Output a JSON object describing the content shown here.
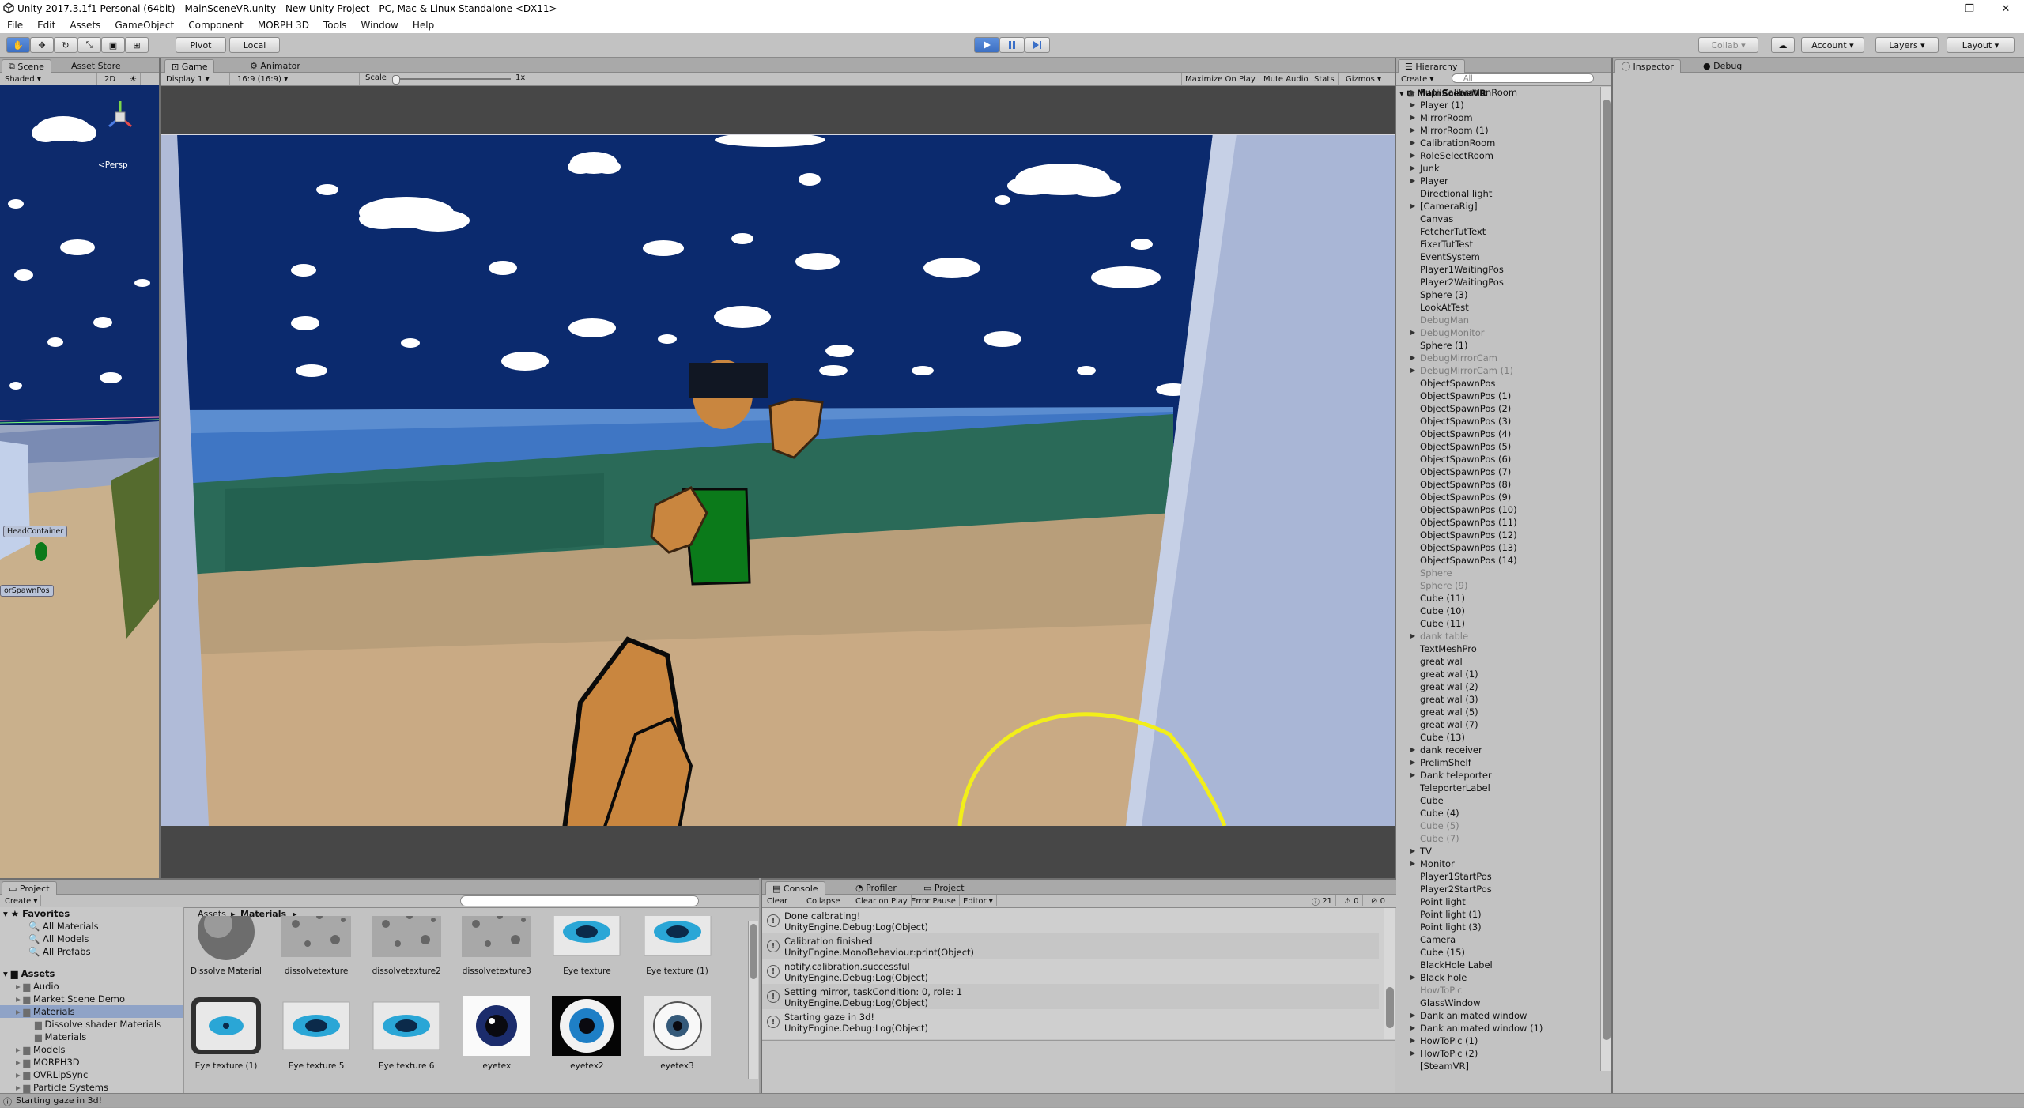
{
  "window": {
    "title": "Unity 2017.3.1f1 Personal (64bit) - MainSceneVR.unity - New Unity Project - PC, Mac & Linux Standalone <DX11>"
  },
  "menu": [
    "File",
    "Edit",
    "Assets",
    "GameObject",
    "Component",
    "MORPH 3D",
    "Tools",
    "Window",
    "Help"
  ],
  "toolbar": {
    "pivot": "Pivot",
    "local": "Local",
    "collab": "Collab",
    "account": "Account",
    "layers": "Layers",
    "layout": "Layout"
  },
  "scene": {
    "tab": "Scene",
    "asset_store": "Asset Store",
    "shaded": "Shaded",
    "mode2d": "2D",
    "persp": "<Persp",
    "head_label": "HeadContainer",
    "spawn_label": "orSpawnPos"
  },
  "game": {
    "tab": "Game",
    "animator": "Animator",
    "display": "Display 1",
    "ratio": "16:9 (16:9)",
    "scale_label": "Scale",
    "scale_value": "1x",
    "maximize": "Maximize On Play",
    "mute": "Mute Audio",
    "stats": "Stats",
    "gizmos": "Gizmos"
  },
  "hierarchy": {
    "tab": "Hierarchy",
    "create": "Create",
    "search_placeholder": "All",
    "root": "MainSceneVR",
    "items": [
      {
        "label": "PupilCalibrationRoom",
        "arrow": true
      },
      {
        "label": "Player (1)",
        "arrow": true
      },
      {
        "label": "MirrorRoom",
        "arrow": true
      },
      {
        "label": "MirrorRoom (1)",
        "arrow": true
      },
      {
        "label": "CalibrationRoom",
        "arrow": true
      },
      {
        "label": "RoleSelectRoom",
        "arrow": true
      },
      {
        "label": "Junk",
        "arrow": true
      },
      {
        "label": "Player",
        "arrow": true
      },
      {
        "label": "Directional light"
      },
      {
        "label": "[CameraRig]",
        "arrow": true
      },
      {
        "label": "Canvas"
      },
      {
        "label": "FetcherTutText"
      },
      {
        "label": "FixerTutTest"
      },
      {
        "label": "EventSystem"
      },
      {
        "label": "Player1WaitingPos"
      },
      {
        "label": "Player2WaitingPos"
      },
      {
        "label": "Sphere (3)"
      },
      {
        "label": "LookAtTest"
      },
      {
        "label": "DebugMan",
        "dim": true
      },
      {
        "label": "DebugMonitor",
        "arrow": true,
        "dim": true
      },
      {
        "label": "Sphere (1)"
      },
      {
        "label": "DebugMirrorCam",
        "arrow": true,
        "dim": true
      },
      {
        "label": "DebugMirrorCam (1)",
        "arrow": true,
        "dim": true
      },
      {
        "label": "ObjectSpawnPos"
      },
      {
        "label": "ObjectSpawnPos (1)"
      },
      {
        "label": "ObjectSpawnPos (2)"
      },
      {
        "label": "ObjectSpawnPos (3)"
      },
      {
        "label": "ObjectSpawnPos (4)"
      },
      {
        "label": "ObjectSpawnPos (5)"
      },
      {
        "label": "ObjectSpawnPos (6)"
      },
      {
        "label": "ObjectSpawnPos (7)"
      },
      {
        "label": "ObjectSpawnPos (8)"
      },
      {
        "label": "ObjectSpawnPos (9)"
      },
      {
        "label": "ObjectSpawnPos (10)"
      },
      {
        "label": "ObjectSpawnPos (11)"
      },
      {
        "label": "ObjectSpawnPos (12)"
      },
      {
        "label": "ObjectSpawnPos (13)"
      },
      {
        "label": "ObjectSpawnPos (14)"
      },
      {
        "label": "Sphere",
        "dim": true
      },
      {
        "label": "Sphere (9)",
        "dim": true
      },
      {
        "label": "Cube (11)"
      },
      {
        "label": "Cube (10)"
      },
      {
        "label": "Cube (11)"
      },
      {
        "label": "dank table",
        "arrow": true,
        "dim": true
      },
      {
        "label": "TextMeshPro"
      },
      {
        "label": "great wal"
      },
      {
        "label": "great wal (1)"
      },
      {
        "label": "great wal (2)"
      },
      {
        "label": "great wal (3)"
      },
      {
        "label": "great wal (5)"
      },
      {
        "label": "great wal (7)"
      },
      {
        "label": "Cube (13)"
      },
      {
        "label": "dank receiver",
        "arrow": true
      },
      {
        "label": "PrelimShelf",
        "arrow": true
      },
      {
        "label": "Dank teleporter",
        "arrow": true
      },
      {
        "label": "TeleporterLabel"
      },
      {
        "label": "Cube"
      },
      {
        "label": "Cube (4)"
      },
      {
        "label": "Cube (5)",
        "dim": true
      },
      {
        "label": "Cube (7)",
        "dim": true
      },
      {
        "label": "TV",
        "arrow": true
      },
      {
        "label": "Monitor",
        "arrow": true
      },
      {
        "label": "Player1StartPos"
      },
      {
        "label": "Player2StartPos"
      },
      {
        "label": "Point light"
      },
      {
        "label": "Point light (1)"
      },
      {
        "label": "Point light (3)"
      },
      {
        "label": "Camera"
      },
      {
        "label": "Cube (15)"
      },
      {
        "label": "BlackHole Label"
      },
      {
        "label": "Black hole",
        "arrow": true
      },
      {
        "label": "HowToPic",
        "dim": true
      },
      {
        "label": "GlassWindow"
      },
      {
        "label": "Dank animated window",
        "arrow": true
      },
      {
        "label": "Dank animated window (1)",
        "arrow": true
      },
      {
        "label": "HowToPic (1)",
        "arrow": true
      },
      {
        "label": "HowToPic (2)",
        "arrow": true
      },
      {
        "label": "[SteamVR]"
      }
    ]
  },
  "inspector": {
    "tab": "Inspector",
    "debug": "Debug"
  },
  "project": {
    "tab": "Project",
    "create": "Create",
    "breadcrumb_root": "Assets",
    "breadcrumb_current": "Materials",
    "favorites": "Favorites",
    "fav_items": [
      "All Materials",
      "All Models",
      "All Prefabs"
    ],
    "assets": "Assets",
    "tree": [
      {
        "label": "Audio",
        "indent": 1
      },
      {
        "label": "Market Scene Demo",
        "indent": 1
      },
      {
        "label": "Materials",
        "indent": 1,
        "selected": true
      },
      {
        "label": "Dissolve shader Materials",
        "indent": 2
      },
      {
        "label": "Materials",
        "indent": 2
      },
      {
        "label": "Models",
        "indent": 1
      },
      {
        "label": "MORPH3D",
        "indent": 1
      },
      {
        "label": "OVRLipSync",
        "indent": 1
      },
      {
        "label": "Particle Systems",
        "indent": 1
      }
    ],
    "tiles_row1": [
      "Dissolve Material",
      "dissolvetexture",
      "dissolvetexture2",
      "dissolvetexture3",
      "Eye texture",
      "Eye texture (1)"
    ],
    "tiles_row2": [
      "Eye texture (1)",
      "Eye texture 5",
      "Eye texture 6",
      "eyetex",
      "eyetex2",
      "eyetex3"
    ]
  },
  "console": {
    "tab": "Console",
    "profiler": "Profiler",
    "project_tab": "Project",
    "buttons": [
      "Clear",
      "Collapse",
      "Clear on Play",
      "Error Pause",
      "Editor"
    ],
    "counts": {
      "info": "21",
      "warn": "0",
      "error": "0"
    },
    "entries": [
      {
        "l1": "Done calbrating!",
        "l2": "UnityEngine.Debug:Log(Object)"
      },
      {
        "l1": "Calibration finished",
        "l2": "UnityEngine.MonoBehaviour:print(Object)"
      },
      {
        "l1": "notify.calibration.successful",
        "l2": "UnityEngine.Debug:Log(Object)"
      },
      {
        "l1": "Setting mirror, taskCondition: 0, role: 1",
        "l2": "UnityEngine.Debug:Log(Object)"
      },
      {
        "l1": "Starting gaze in 3d!",
        "l2": "UnityEngine.Debug:Log(Object)"
      }
    ]
  },
  "status": {
    "text": "Starting gaze in 3d!"
  },
  "colors": {
    "play_blue": "#3c6fc2",
    "sky": "#0e2a6e",
    "yellow_ring": "#f2ee1a"
  }
}
